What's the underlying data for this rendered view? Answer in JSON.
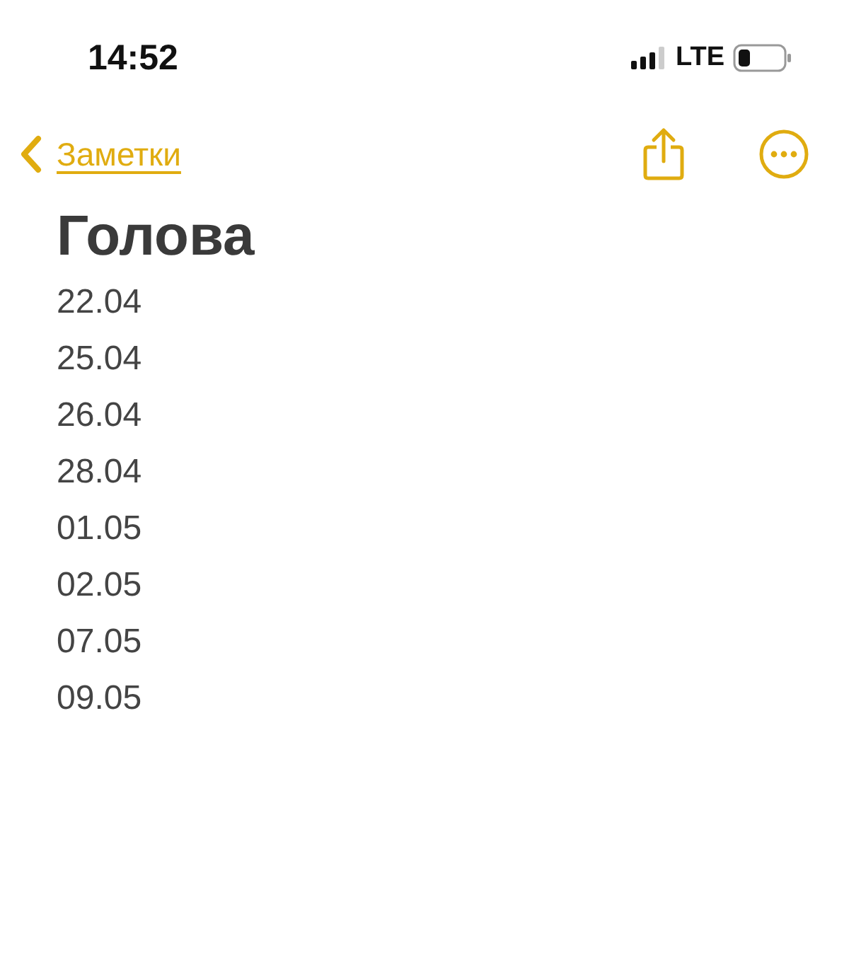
{
  "status_bar": {
    "time": "14:52",
    "network": "LTE"
  },
  "nav": {
    "back_label": "Заметки"
  },
  "note": {
    "title": "Голова",
    "lines": [
      "22.04",
      "25.04",
      "26.04",
      "28.04",
      "01.05",
      "02.05",
      "07.05",
      "09.05"
    ]
  }
}
